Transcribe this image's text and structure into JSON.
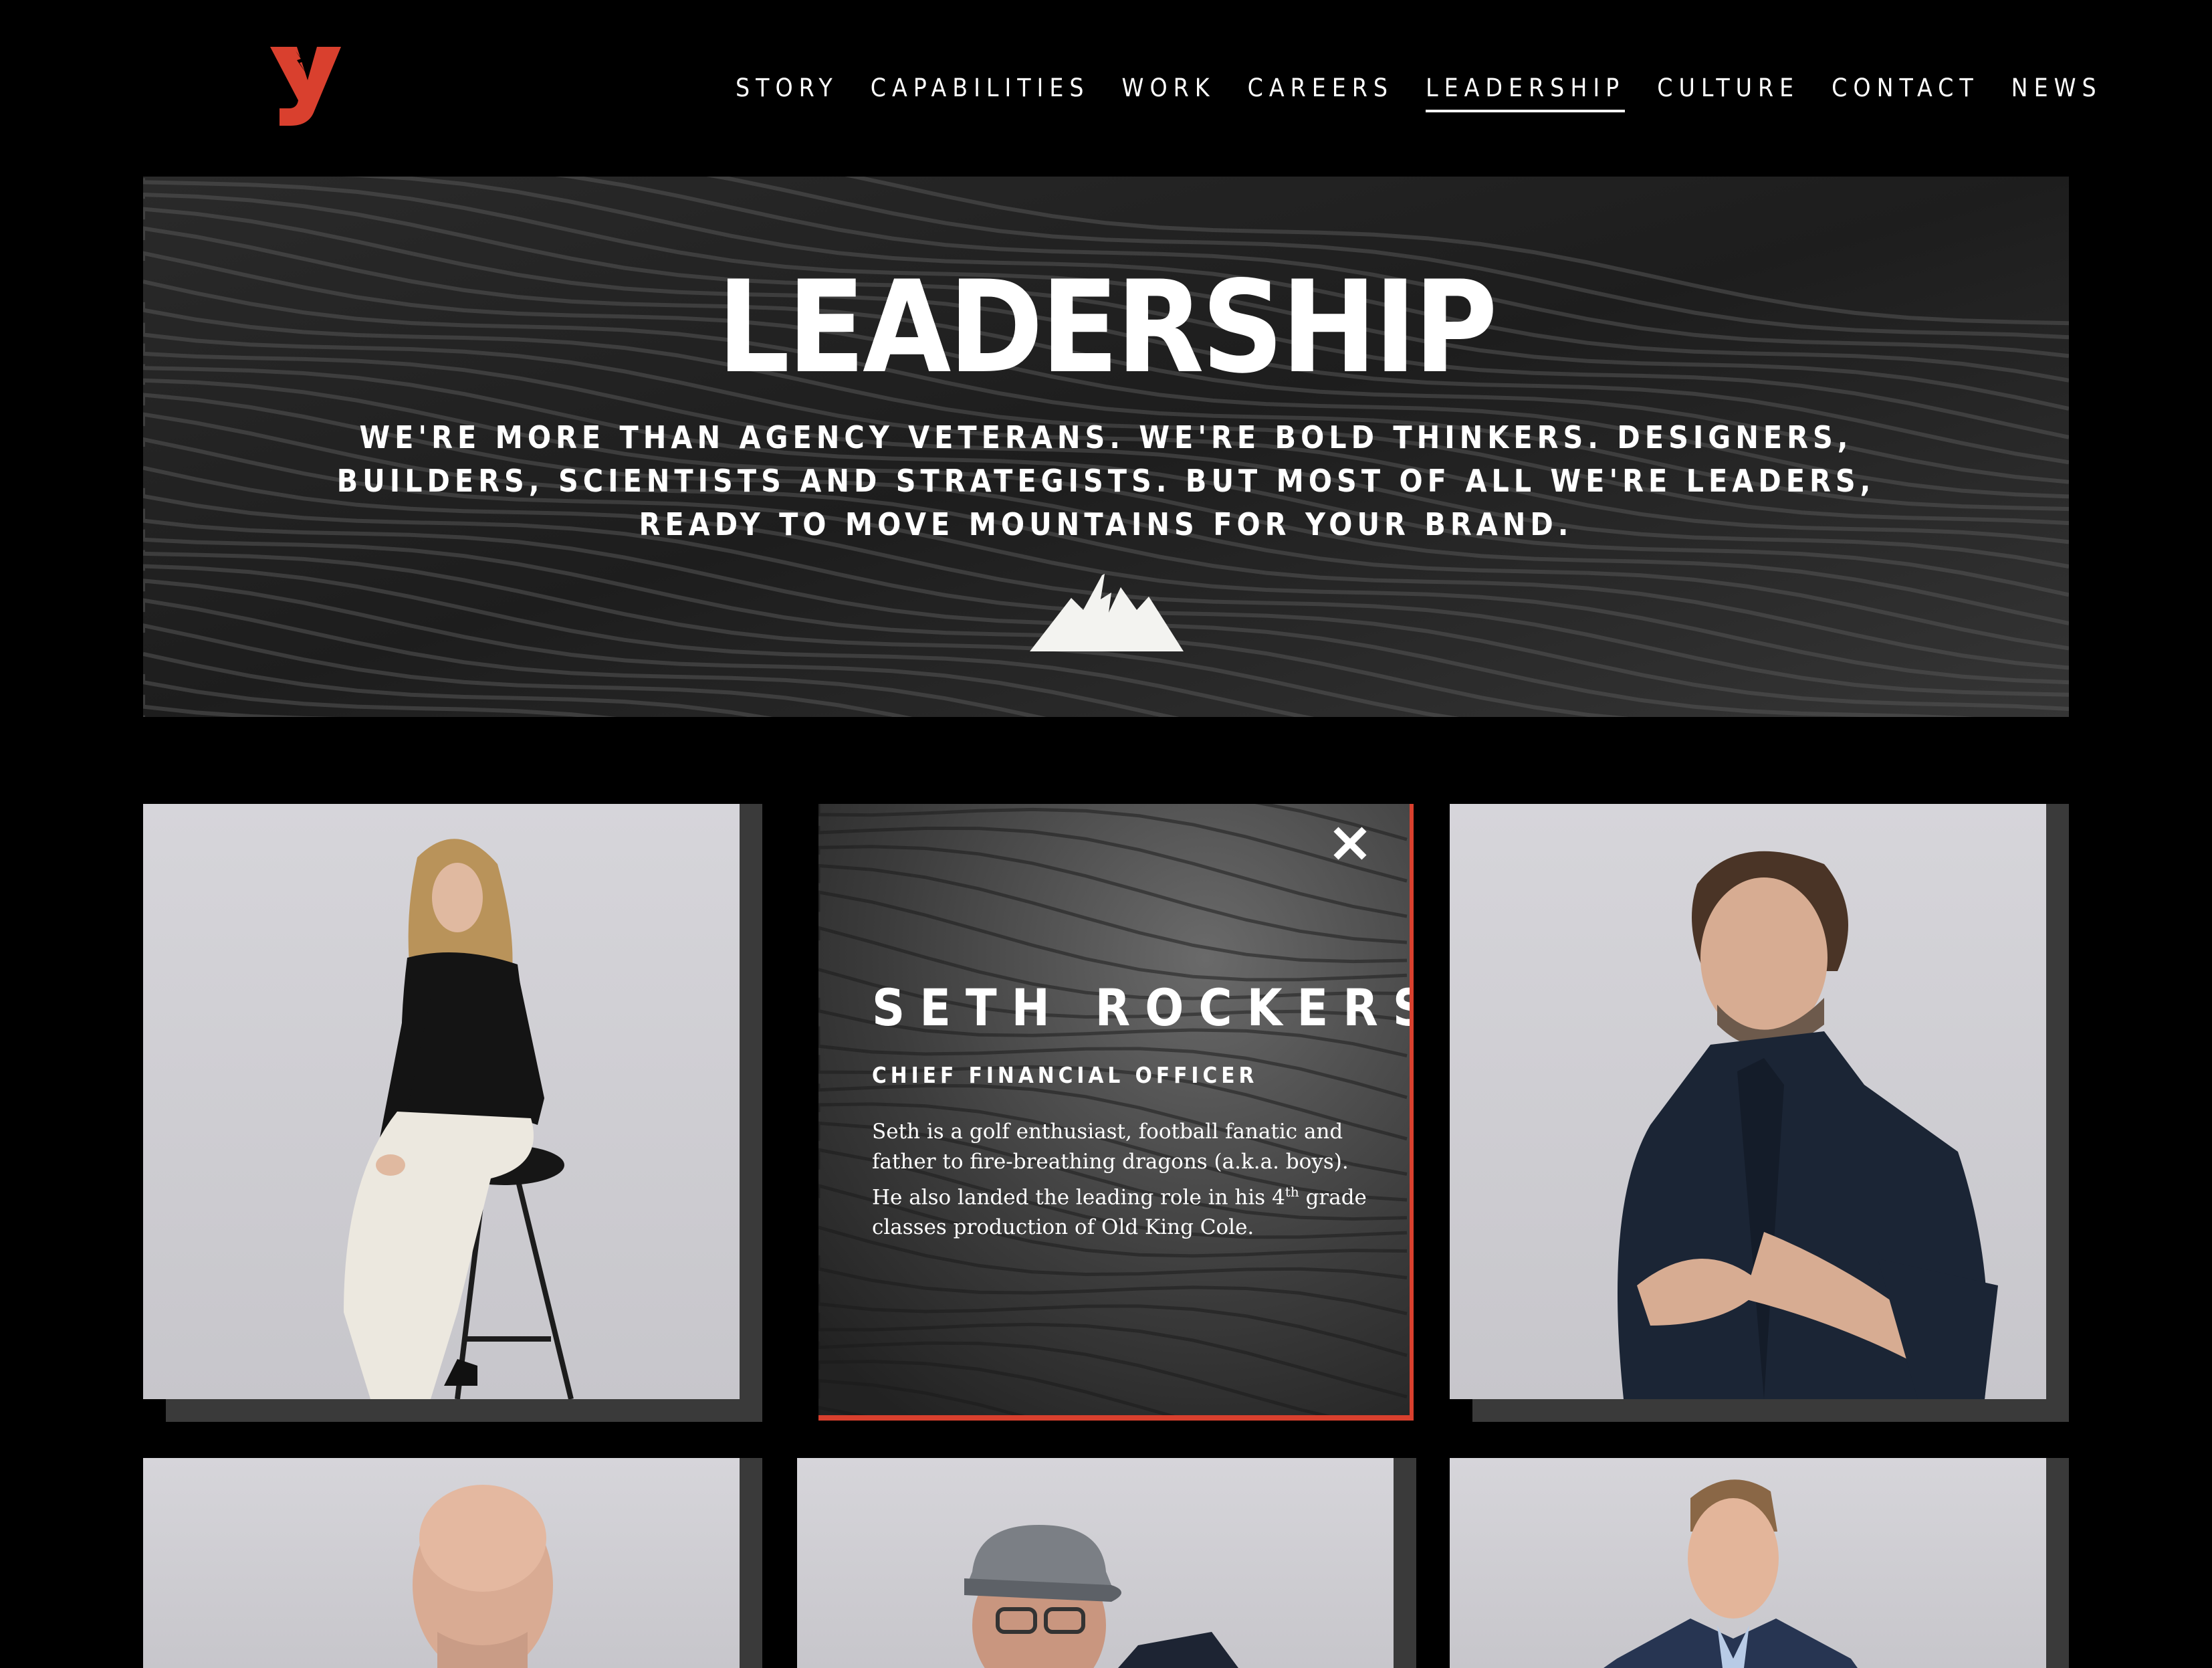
{
  "brand": {
    "logo_letter": "y",
    "accent_color": "#d9402e"
  },
  "nav": {
    "items": [
      {
        "label": "STORY",
        "active": false
      },
      {
        "label": "CAPABILITIES",
        "active": false
      },
      {
        "label": "WORK",
        "active": false
      },
      {
        "label": "CAREERS",
        "active": false
      },
      {
        "label": "LEADERSHIP",
        "active": true
      },
      {
        "label": "CULTURE",
        "active": false
      },
      {
        "label": "CONTACT",
        "active": false
      },
      {
        "label": "NEWS",
        "active": false
      }
    ]
  },
  "hero": {
    "title": "LEADERSHIP",
    "subtitle": "WE'RE MORE THAN AGENCY VETERANS. WE'RE BOLD THINKERS. DESIGNERS, BUILDERS, SCIENTISTS AND STRATEGISTS. BUT MOST OF ALL WE'RE LEADERS, READY TO MOVE MOUNTAINS FOR YOUR BRAND.",
    "icon": "mountain-icon"
  },
  "bio": {
    "name": "SETH ROCKERS",
    "role": "CHIEF FINANCIAL OFFICER",
    "text_before": "Seth is a golf enthusiast, football fanatic and father to fire-breathing dragons (a.k.a. boys). He also landed the leading role in his 4",
    "text_sup": "th",
    "text_after": " grade classes production of Old King Cole.",
    "close_icon": "close-icon"
  }
}
